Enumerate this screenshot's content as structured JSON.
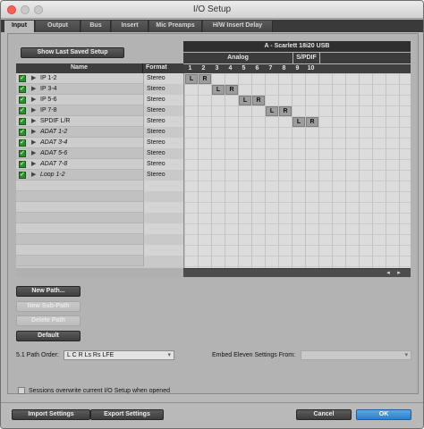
{
  "window": {
    "title": "I/O Setup"
  },
  "tabs": [
    {
      "label": "Input",
      "active": true
    },
    {
      "label": "Output"
    },
    {
      "label": "Bus"
    },
    {
      "label": "Insert"
    },
    {
      "label": "Mic Preamps"
    },
    {
      "label": "H/W Insert Delay"
    }
  ],
  "buttons": {
    "show_last_saved": "Show Last Saved Setup",
    "new_path": "New Path...",
    "new_subpath": "New Sub-Path",
    "delete_path": "Delete Path",
    "default": "Default",
    "import_settings": "Import Settings",
    "export_settings": "Export Settings",
    "cancel": "Cancel",
    "ok": "OK"
  },
  "list": {
    "col_name": "Name",
    "col_format": "Format",
    "rows": [
      {
        "name": "IP 1-2",
        "format": "Stereo",
        "checked": true,
        "italic": false
      },
      {
        "name": "IP 3-4",
        "format": "Stereo",
        "checked": true,
        "italic": false
      },
      {
        "name": "IP 5-6",
        "format": "Stereo",
        "checked": true,
        "italic": false
      },
      {
        "name": "IP 7-8",
        "format": "Stereo",
        "checked": true,
        "italic": false
      },
      {
        "name": "SPDIF L/R",
        "format": "Stereo",
        "checked": true,
        "italic": false
      },
      {
        "name": "ADAT 1-2",
        "format": "Stereo",
        "checked": true,
        "italic": true
      },
      {
        "name": "ADAT 3-4",
        "format": "Stereo",
        "checked": true,
        "italic": true
      },
      {
        "name": "ADAT 5-6",
        "format": "Stereo",
        "checked": true,
        "italic": true
      },
      {
        "name": "ADAT 7-8",
        "format": "Stereo",
        "checked": true,
        "italic": true
      },
      {
        "name": "Loop 1-2",
        "format": "Stereo",
        "checked": true,
        "italic": true
      }
    ]
  },
  "grid": {
    "device": "A - Scarlett 18i20 USB",
    "group_analog": "Analog",
    "group_spdif": "S/PDIF",
    "channels": [
      "1",
      "2",
      "3",
      "4",
      "5",
      "6",
      "7",
      "8",
      "9",
      "10"
    ],
    "assignments": [
      {
        "row": 0,
        "col": 0,
        "label": "L"
      },
      {
        "row": 0,
        "col": 1,
        "label": "R"
      },
      {
        "row": 1,
        "col": 2,
        "label": "L"
      },
      {
        "row": 1,
        "col": 3,
        "label": "R"
      },
      {
        "row": 2,
        "col": 4,
        "label": "L"
      },
      {
        "row": 2,
        "col": 5,
        "label": "R"
      },
      {
        "row": 3,
        "col": 6,
        "label": "L"
      },
      {
        "row": 3,
        "col": 7,
        "label": "R"
      },
      {
        "row": 4,
        "col": 8,
        "label": "L"
      },
      {
        "row": 4,
        "col": 9,
        "label": "R"
      }
    ]
  },
  "path_order": {
    "label": "5.1 Path Order:",
    "value": "L C R Ls Rs LFE"
  },
  "embed": {
    "label": "Embed Eleven Settings From:",
    "value": ""
  },
  "sessions_overwrite": {
    "label": "Sessions overwrite current I/O Setup when opened",
    "checked": false
  },
  "colors": {
    "ok_button": "#2c7fcf",
    "checkbox_green": "#2f8f2f",
    "assignment": "#9d9d9d"
  }
}
